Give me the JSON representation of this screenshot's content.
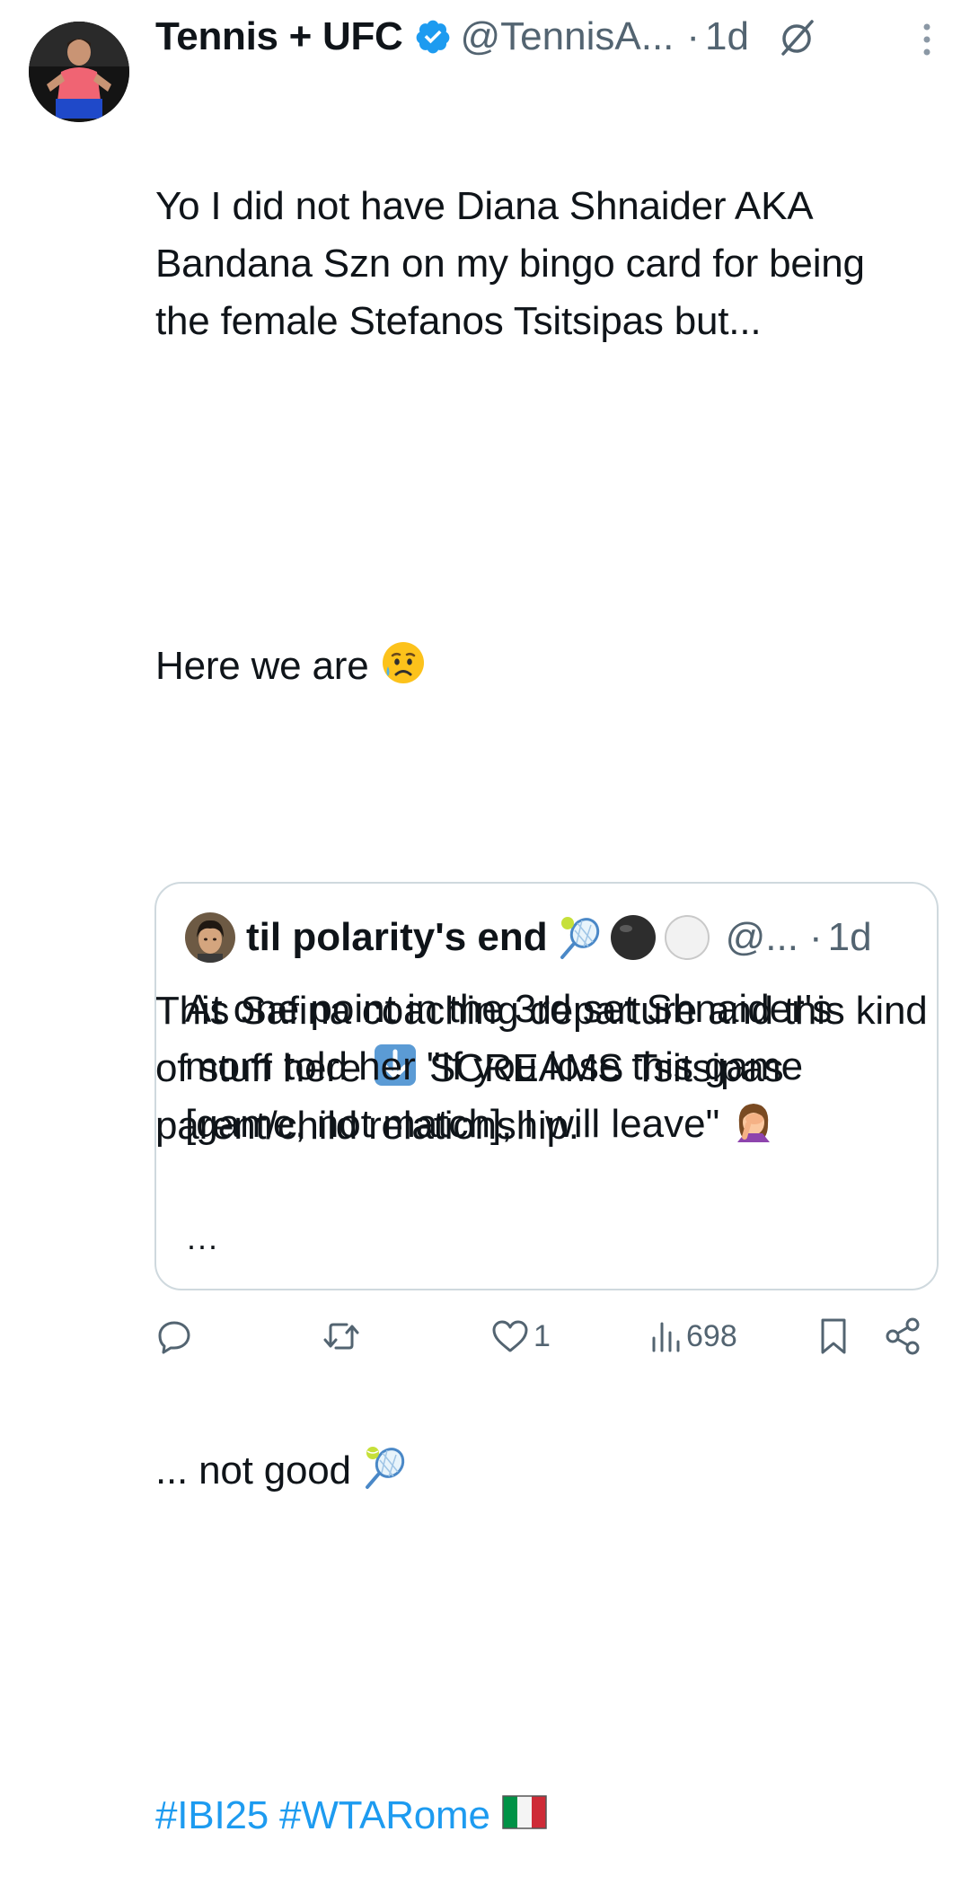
{
  "tweet": {
    "author": {
      "display_name": "Tennis + UFC",
      "handle": "@TennisA...",
      "time": "1d",
      "separator": "·"
    },
    "body": {
      "p1": "Yo I did not have Diana Shnaider AKA Bandana Szn on my bingo card for being the female Stefanos Tsitsipas but...",
      "p2": "Here we are",
      "p3a": "This Safina coaching departure and this kind of stuff here",
      "p3b": "SCREAMS Tsitsipas parent/child relationship.",
      "p4": "... not good",
      "hashtag1": "#IBI25",
      "hashtag2": "#WTARome"
    },
    "icons": {
      "verified": "verified-badge-icon",
      "grok": "grok-icon",
      "more": "more-vertical-icon"
    },
    "accent_color": "#1d9bf0"
  },
  "quote": {
    "display_name": "til polarity's end",
    "handle": "@...",
    "separator": "·",
    "time": "1d",
    "text": "At one point in the 3rd set Shnaider's mom told her \"If you lose this game [game, not match], I will leave\"",
    "ellipsis": "..."
  },
  "actions": {
    "reply": {
      "icon": "reply-icon",
      "count": ""
    },
    "retweet": {
      "icon": "retweet-icon",
      "count": ""
    },
    "like": {
      "icon": "heart-icon",
      "count": "1"
    },
    "views": {
      "icon": "views-icon",
      "count": "698"
    },
    "bookmark": {
      "icon": "bookmark-icon"
    },
    "share": {
      "icon": "share-icon"
    }
  }
}
